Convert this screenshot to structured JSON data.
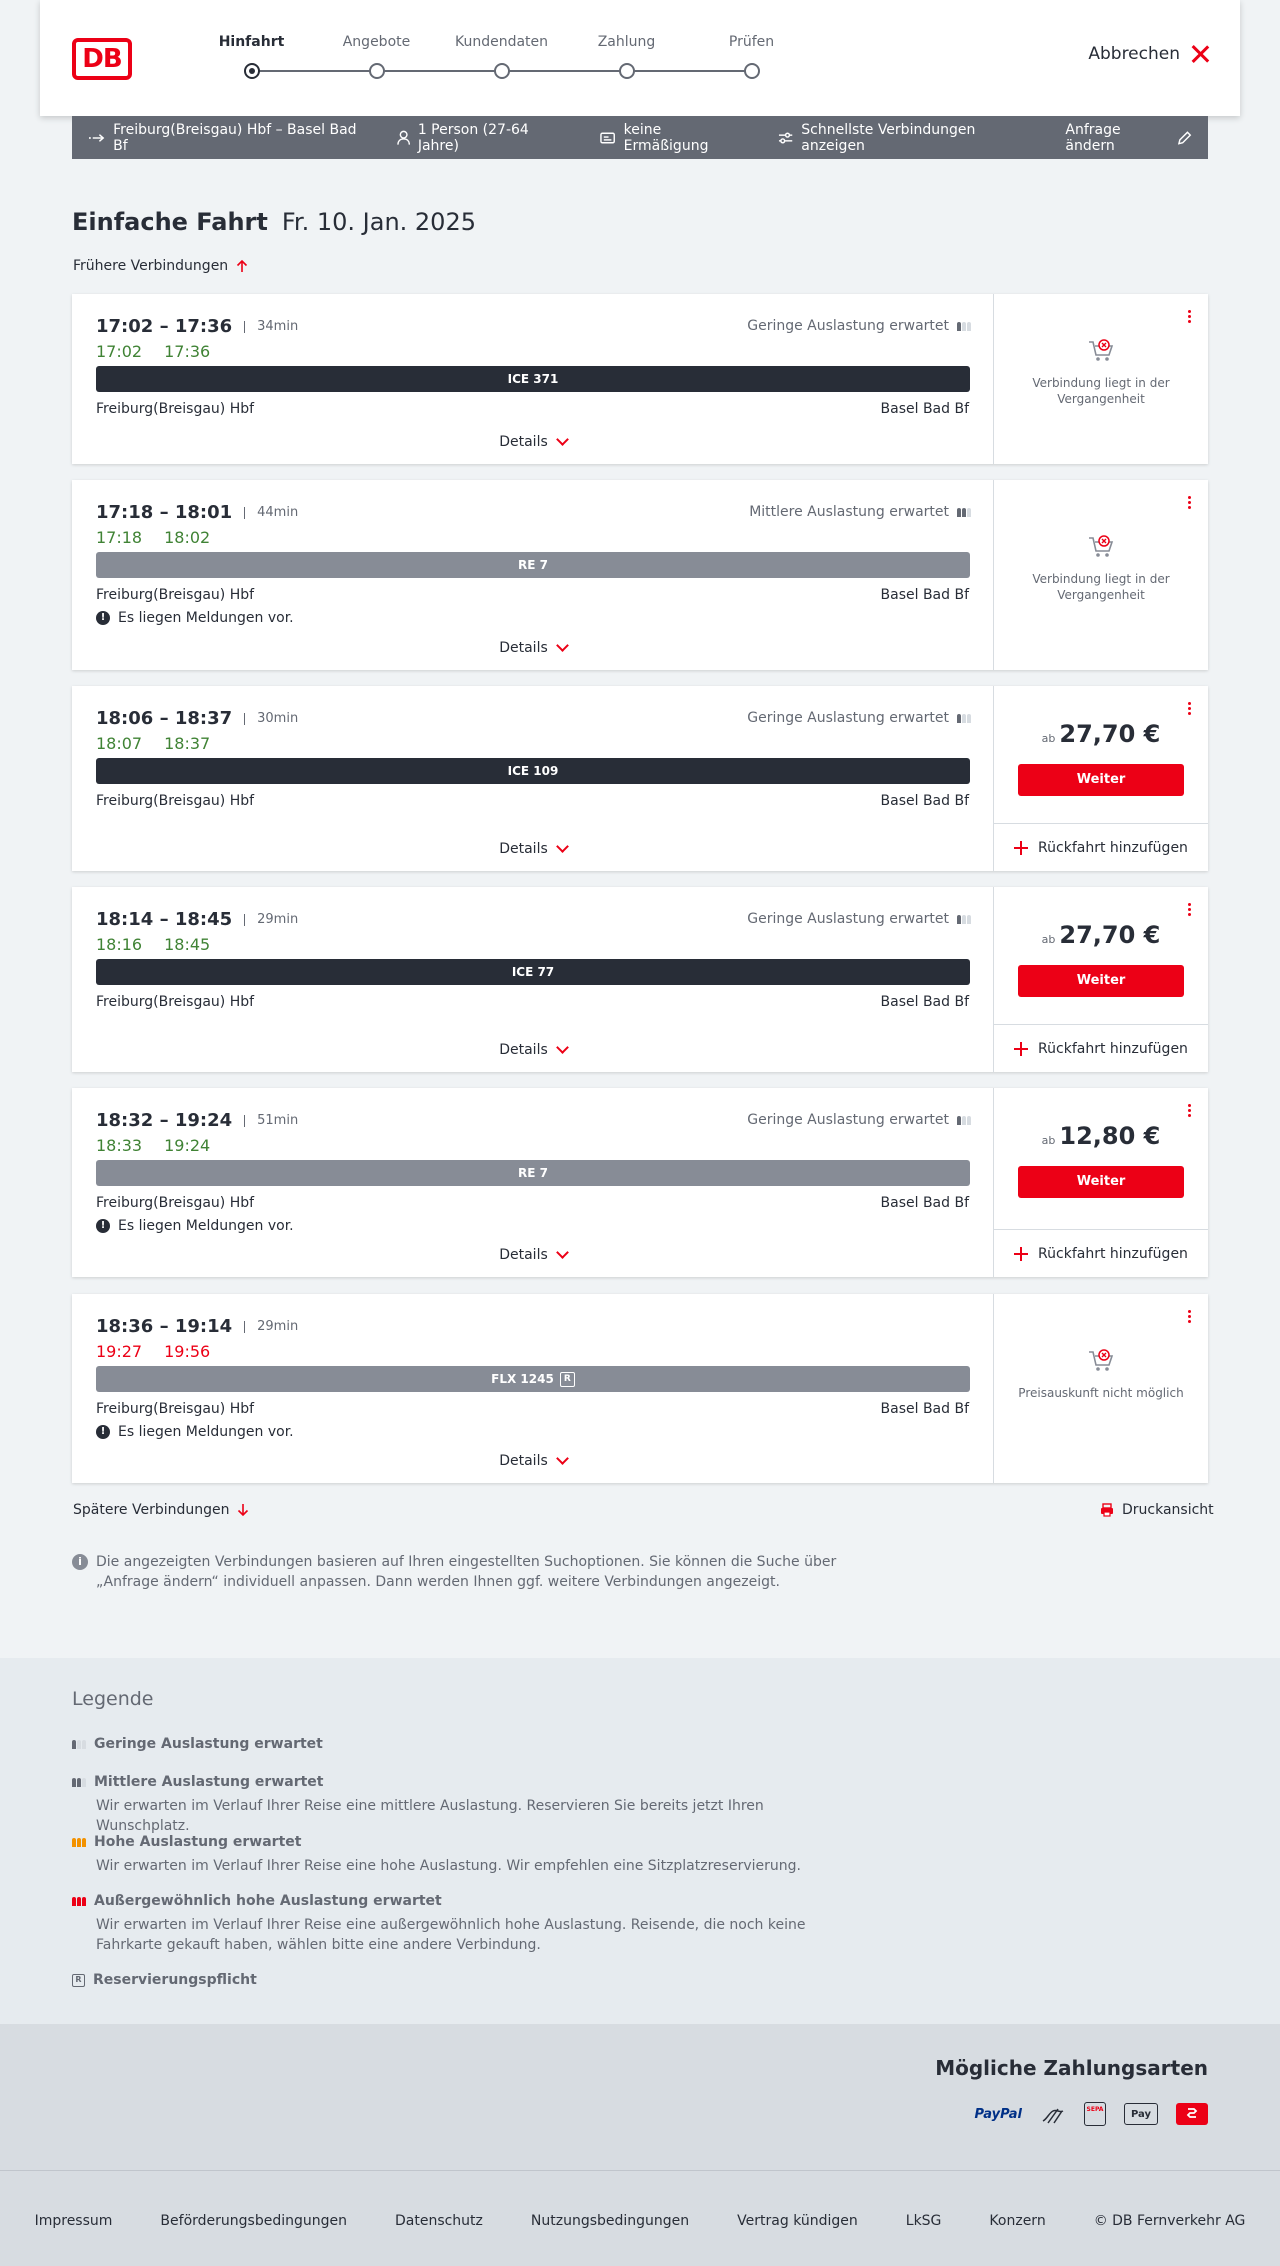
{
  "header": {
    "logo_text": "DB",
    "steps": [
      {
        "label": "Hinfahrt",
        "active": true
      },
      {
        "label": "Angebote",
        "active": false
      },
      {
        "label": "Kundendaten",
        "active": false
      },
      {
        "label": "Zahlung",
        "active": false
      },
      {
        "label": "Prüfen",
        "active": false
      }
    ],
    "cancel_label": "Abbrechen"
  },
  "search_bar": {
    "route": "Freiburg(Breisgau) Hbf – Basel Bad Bf",
    "passengers": "1 Person (27-64 Jahre)",
    "discount": "keine Ermäßigung",
    "fastest": "Schnellste Verbindungen anzeigen",
    "change_request": "Anfrage ändern"
  },
  "page": {
    "title": "Einfache Fahrt",
    "date": "Fr. 10. Jan. 2025",
    "earlier": "Frühere Verbindungen",
    "later": "Spätere Verbindungen",
    "print": "Druckansicht",
    "details_label": "Details",
    "price_prefix": "ab",
    "continue_label": "Weiter",
    "return_label": "Rückfahrt hinzufügen",
    "info_text": "Die angezeigten Verbindungen basieren auf Ihren eingestellten Suchoptionen. Sie können die Suche über „Anfrage ändern“ individuell anpassen. Dann werden Ihnen ggf. weitere Verbindungen angezeigt."
  },
  "connections": [
    {
      "times": "17:02 – 17:36",
      "duration": "34min",
      "rt_dep": "17:02",
      "rt_arr": "17:36",
      "late": false,
      "load": "Geringe Auslastung erwartet",
      "load_level": 1,
      "train": "ICE 371",
      "train_type": "ice",
      "from": "Freiburg(Breisgau) Hbf",
      "to": "Basel Bad Bf",
      "message": "",
      "status": "past",
      "status_text": "Verbindung liegt in der Vergangenheit"
    },
    {
      "times": "17:18 – 18:01",
      "duration": "44min",
      "rt_dep": "17:18",
      "rt_arr": "18:02",
      "late": false,
      "load": "Mittlere Auslastung erwartet",
      "load_level": 2,
      "train": "RE 7",
      "train_type": "re",
      "from": "Freiburg(Breisgau) Hbf",
      "to": "Basel Bad Bf",
      "message": "Es liegen Meldungen vor.",
      "status": "past",
      "status_text": "Verbindung liegt in der Vergangenheit"
    },
    {
      "times": "18:06 – 18:37",
      "duration": "30min",
      "rt_dep": "18:07",
      "rt_arr": "18:37",
      "late": false,
      "load": "Geringe Auslastung erwartet",
      "load_level": 1,
      "train": "ICE 109",
      "train_type": "ice",
      "from": "Freiburg(Breisgau) Hbf",
      "to": "Basel Bad Bf",
      "message": "",
      "status": "price",
      "price": "27,70 €"
    },
    {
      "times": "18:14 – 18:45",
      "duration": "29min",
      "rt_dep": "18:16",
      "rt_arr": "18:45",
      "late": false,
      "load": "Geringe Auslastung erwartet",
      "load_level": 1,
      "train": "ICE 77",
      "train_type": "ice",
      "from": "Freiburg(Breisgau) Hbf",
      "to": "Basel Bad Bf",
      "message": "",
      "status": "price",
      "price": "27,70 €"
    },
    {
      "times": "18:32 – 19:24",
      "duration": "51min",
      "rt_dep": "18:33",
      "rt_arr": "19:24",
      "late": false,
      "load": "Geringe Auslastung erwartet",
      "load_level": 1,
      "train": "RE 7",
      "train_type": "re",
      "from": "Freiburg(Breisgau) Hbf",
      "to": "Basel Bad Bf",
      "message": "Es liegen Meldungen vor.",
      "status": "price",
      "price": "12,80 €"
    },
    {
      "times": "18:36 – 19:14",
      "duration": "29min",
      "rt_dep": "19:27",
      "rt_arr": "19:56",
      "late": true,
      "load": "",
      "load_level": 0,
      "train": "FLX 1245",
      "train_badge": "R",
      "train_type": "re",
      "from": "Freiburg(Breisgau) Hbf",
      "to": "Basel Bad Bf",
      "message": "Es liegen Meldungen vor.",
      "status": "na",
      "status_text": "Preisauskunft nicht möglich"
    }
  ],
  "legend": {
    "title": "Legende",
    "items": [
      {
        "title": "Geringe Auslastung erwartet",
        "desc": ""
      },
      {
        "title": "Mittlere Auslastung erwartet",
        "desc": "Wir erwarten im Verlauf Ihrer Reise eine mittlere Auslastung. Reservieren Sie bereits jetzt Ihren Wunschplatz."
      },
      {
        "title": "Hohe Auslastung erwartet",
        "desc": "Wir erwarten im Verlauf Ihrer Reise eine hohe Auslastung. Wir empfehlen eine Sitzplatzreservierung."
      },
      {
        "title": "Außergewöhnlich hohe Auslastung erwartet",
        "desc": "Wir erwarten im Verlauf Ihrer Reise eine außergewöhnlich hohe Auslastung. Reisende, die noch keine Fahrkarte gekauft haben, wählen bitte eine andere Verbindung."
      },
      {
        "title": "Reservierungspflicht",
        "desc": ""
      }
    ]
  },
  "payment": {
    "title": "Mögliche Zahlungsarten",
    "paypal_text": "PayPal",
    "applepay_text": "Pay",
    "sepa_text": "SEPA"
  },
  "footer": {
    "links": [
      "Impressum",
      "Beförderungsbedingungen",
      "Datenschutz",
      "Nutzungsbedingungen",
      "Vertrag kündigen",
      "LkSG",
      "Konzern",
      "© DB Fernverkehr AG"
    ]
  },
  "colors": {
    "brand": "#ec0016",
    "ontime": "#408335",
    "bar": "#646973",
    "dark": "#282d37"
  }
}
